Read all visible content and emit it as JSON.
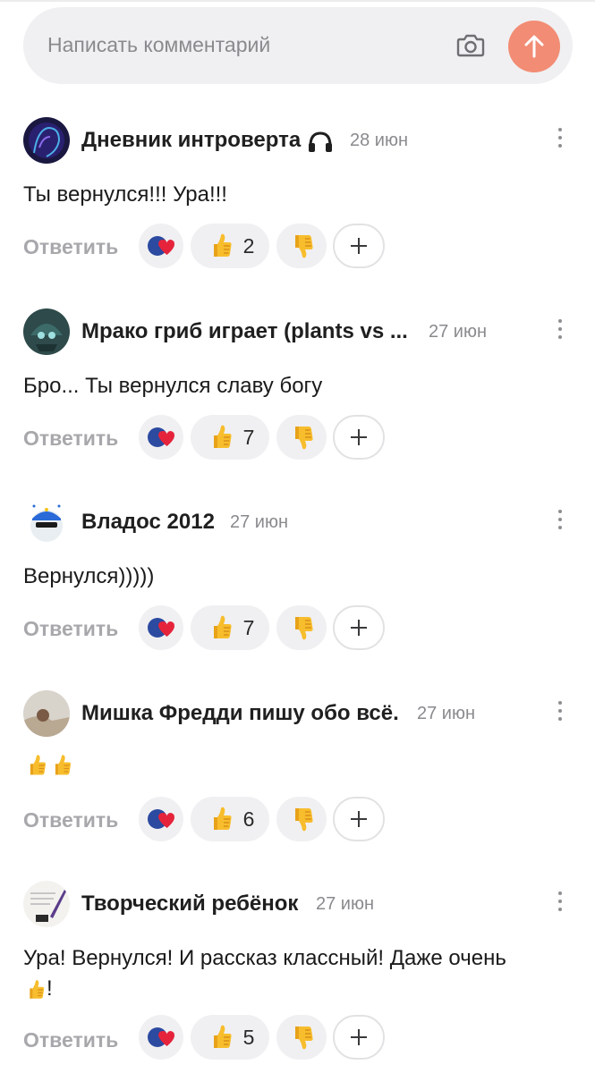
{
  "input": {
    "placeholder": "Написать комментарий"
  },
  "colors": {
    "accent": "#f28c74",
    "pill_bg": "#f0f0f2",
    "muted": "#8a8a8e"
  },
  "icons": {
    "camera": "camera-icon",
    "send": "arrow-up-icon",
    "more": "more-vertical-icon",
    "reaction_like": "heart-icon",
    "reaction_thumb_up": "thumbs-up-icon",
    "reaction_thumb_down": "thumbs-down-icon",
    "add": "plus-icon",
    "headphones": "headphones-icon"
  },
  "comments": [
    {
      "author": "Дневник интроверта",
      "date": "28 июн",
      "text": "Ты вернулся!!! Ура!!!",
      "reply": "Ответить",
      "likes": "2"
    },
    {
      "author": "Мрако гриб играет (plants vs ...",
      "date": "27 июн",
      "text": "Бро... Ты вернулся славу богу",
      "reply": "Ответить",
      "likes": "7"
    },
    {
      "author": "Владос 2012",
      "date": "27 июн",
      "text": "Вернулся)))))",
      "reply": "Ответить",
      "likes": "7"
    },
    {
      "author": "Мишка Фредди пишу обо всё.",
      "date": "27 июн",
      "text": "",
      "reply": "Ответить",
      "likes": "6"
    },
    {
      "author": "Творческий ребёнок",
      "date": "27 июн",
      "text": "Ура! Вернулся! И рассказ классный! Даже очень",
      "text_end": "!",
      "reply": "Ответить",
      "likes": "5"
    }
  ]
}
